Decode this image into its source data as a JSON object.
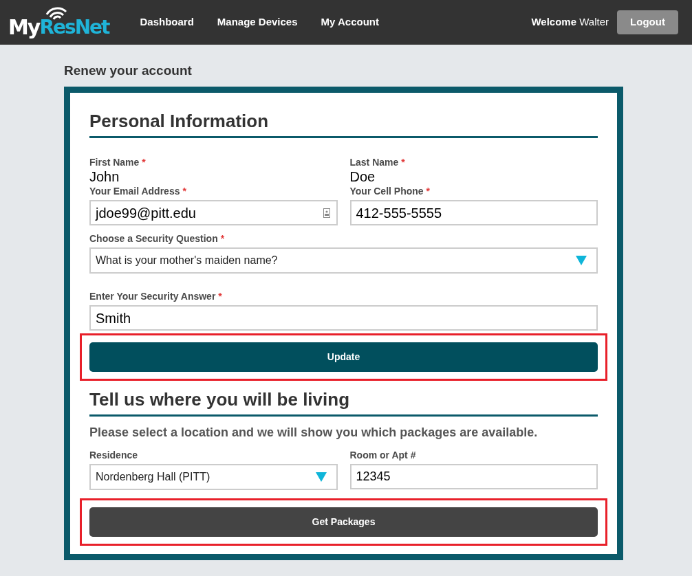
{
  "header": {
    "logo": {
      "prefix": "My",
      "brand": "ResNet"
    },
    "nav": [
      {
        "label": "Dashboard"
      },
      {
        "label": "Manage Devices"
      },
      {
        "label": "My Account"
      }
    ],
    "welcome": {
      "label": "Welcome",
      "name": "Walter"
    },
    "logout": "Logout"
  },
  "page_title": "Renew your account",
  "sections": [
    {
      "heading": "Personal Information",
      "rows": [
        [
          {
            "kind": "text",
            "label": "First Name",
            "required_mark": "*",
            "value": "John"
          },
          {
            "kind": "text",
            "label": "Last Name",
            "required_mark": "*",
            "value": "Doe"
          }
        ],
        [
          {
            "kind": "input",
            "label": "Your Email Address",
            "required_mark": "*",
            "value": "jdoe99@pitt.edu",
            "contact_icon": true
          },
          {
            "kind": "input",
            "label": "Your Cell Phone",
            "required_mark": "*",
            "value": "412-555-5555"
          }
        ],
        [
          {
            "kind": "select",
            "label": "Choose a Security Question",
            "required_mark": "*",
            "value": "What is your mother's maiden name?"
          }
        ],
        [
          {
            "kind": "input",
            "label": "Enter Your Security Answer",
            "required_mark": "*",
            "value": "Smith"
          }
        ]
      ],
      "button": {
        "label": "Update",
        "kind": "primary",
        "highlighted": true
      }
    },
    {
      "heading": "Tell us where you will be living",
      "subtitle": "Please select a location and we will show you which packages are available.",
      "rows": [
        [
          {
            "kind": "select",
            "label": "Residence",
            "value": "Nordenberg Hall (PITT)"
          },
          {
            "kind": "small-input",
            "label": "Room or Apt #",
            "value": "12345"
          }
        ]
      ],
      "button": {
        "label": "Get Packages",
        "kind": "dark",
        "highlighted": true
      }
    }
  ]
}
